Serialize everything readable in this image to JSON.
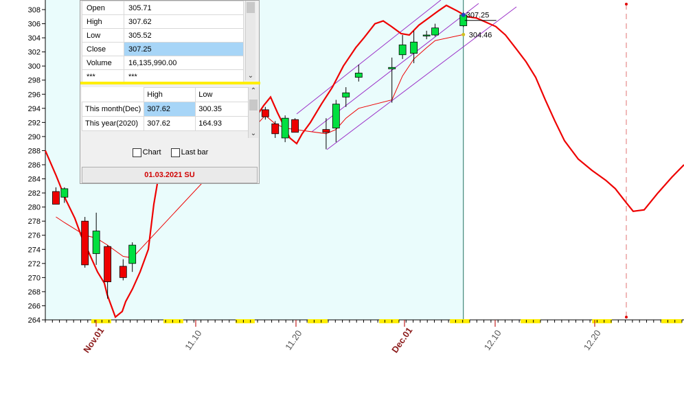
{
  "chart_data": {
    "type": "candlestick",
    "y_axis": {
      "min": 264,
      "max": 308,
      "step": 2,
      "ticks": [
        "308",
        "306",
        "304",
        "302",
        "300",
        "298",
        "296",
        "294",
        "292",
        "290",
        "288",
        "286",
        "284",
        "282",
        "280",
        "278",
        "276",
        "274",
        "272",
        "270",
        "268",
        "266",
        "264"
      ]
    },
    "x_axis": {
      "labels": [
        {
          "text": "Nov.01",
          "major": true
        },
        {
          "text": "11.10",
          "major": false
        },
        {
          "text": "11.20",
          "major": false
        },
        {
          "text": "Dec.01",
          "major": true
        },
        {
          "text": "12.10",
          "major": false
        },
        {
          "text": "12.20",
          "major": false
        }
      ]
    },
    "candles": [
      {
        "o": 282.2,
        "h": 282.8,
        "l": 280.4,
        "c": 280.4,
        "up": false
      },
      {
        "o": 281.4,
        "h": 282.8,
        "l": 280.6,
        "c": 282.6,
        "up": true
      },
      {
        "o": 278.0,
        "h": 278.6,
        "l": 271.4,
        "c": 271.8,
        "up": false
      },
      {
        "o": 273.4,
        "h": 279.2,
        "l": 271.8,
        "c": 276.6,
        "up": true
      },
      {
        "o": 274.4,
        "h": 274.6,
        "l": 267.0,
        "c": 269.4,
        "up": false
      },
      {
        "o": 271.6,
        "h": 272.6,
        "l": 269.6,
        "c": 270.0,
        "up": false
      },
      {
        "o": 272.0,
        "h": 275.0,
        "l": 270.8,
        "c": 274.6,
        "up": true
      },
      {
        "o": 293.8,
        "h": 294.2,
        "l": 292.4,
        "c": 292.8,
        "up": false
      },
      {
        "o": 291.8,
        "h": 292.2,
        "l": 289.8,
        "c": 290.4,
        "up": false
      },
      {
        "o": 289.8,
        "h": 293.0,
        "l": 289.2,
        "c": 292.6,
        "up": true
      },
      {
        "o": 292.4,
        "h": 292.6,
        "l": 290.6,
        "c": 290.6,
        "up": false
      },
      {
        "o": 291.0,
        "h": 292.6,
        "l": 288.2,
        "c": 290.6,
        "up": false
      },
      {
        "o": 291.2,
        "h": 295.2,
        "l": 289.2,
        "c": 294.6,
        "up": true
      },
      {
        "o": 295.6,
        "h": 297.0,
        "l": 294.2,
        "c": 296.2,
        "up": true
      },
      {
        "o": 298.4,
        "h": 300.2,
        "l": 297.8,
        "c": 299.0,
        "up": true
      },
      {
        "o": 299.6,
        "h": 301.2,
        "l": 294.8,
        "c": 299.8,
        "up": true
      },
      {
        "o": 301.6,
        "h": 304.4,
        "l": 301.0,
        "c": 303.0,
        "up": true
      },
      {
        "o": 301.8,
        "h": 305.0,
        "l": 300.4,
        "c": 303.4,
        "up": true
      },
      {
        "o": 304.4,
        "h": 305.0,
        "l": 303.8,
        "c": 304.4,
        "up": true
      },
      {
        "o": 304.4,
        "h": 306.0,
        "l": 304.2,
        "c": 305.4,
        "up": true
      },
      {
        "o": 305.71,
        "h": 307.62,
        "l": 305.52,
        "c": 307.25,
        "up": true
      }
    ],
    "markers": {
      "close": "307.25",
      "ma": "304.46"
    },
    "colors": {
      "up": "#00e040",
      "down": "#ee0000",
      "line": "#ee0000",
      "channel": "#9b30c8",
      "shade": "#eafcfc",
      "weekend": "#ffee00"
    }
  },
  "panel": {
    "ohlc": [
      {
        "key": "Open",
        "value": "305.71"
      },
      {
        "key": "High",
        "value": "307.62"
      },
      {
        "key": "Low",
        "value": "305.52"
      },
      {
        "key": "Close",
        "value": "307.25"
      },
      {
        "key": "Volume",
        "value": "16,135,990.00"
      },
      {
        "key": "***",
        "value": "***"
      }
    ],
    "range_headers": {
      "high": "High",
      "low": "Low"
    },
    "ranges": [
      {
        "label": "This month(Dec)",
        "high": "307.62",
        "low": "300.35"
      },
      {
        "label": "This year(2020)",
        "high": "307.62",
        "low": "164.93"
      }
    ],
    "chart_checkbox": "Chart",
    "lastbar_checkbox": "Last bar",
    "date": "01.03.2021 SU"
  }
}
